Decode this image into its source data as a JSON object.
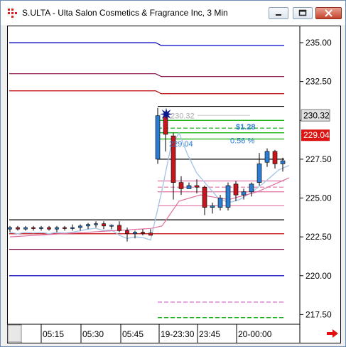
{
  "window": {
    "title": "S.ULTA - Ulta Salon Cosmetics & Fragrance Inc, 3 Min",
    "minimize_icon": "minimize-icon",
    "maximize_icon": "maximize-icon",
    "close_icon": "close-icon",
    "app_icon": "chart-app-icon"
  },
  "colors": {
    "background": "#ffffff",
    "up_candle": "#2a7dd1",
    "down_candle": "#c4161c",
    "last_price_badge": "#e1e1e1",
    "bid_ask_badge": "#dc1414",
    "avg_line": "#a8c6e8",
    "pink_line": "#e070a0"
  },
  "chart_data": {
    "type": "candlestick",
    "title": "S.ULTA - Ulta Salon Cosmetics & Fragrance Inc, 3 Min",
    "ylim": [
      216.5,
      236.5
    ],
    "yticks": [
      235.0,
      232.5,
      230.0,
      227.5,
      225.0,
      222.5,
      220.0,
      217.5
    ],
    "ytick_labels": [
      "235.00",
      "232.50",
      "227.50",
      "225.00",
      "222.50",
      "220.00",
      "217.50"
    ],
    "xtick_labels": [
      "05:15",
      "05:30",
      "05:45",
      "19-23:30",
      "23:45",
      "20-00:00"
    ],
    "last_price": 230.32,
    "last_price_label": "230.32",
    "second_price": 229.04,
    "second_price_label": "229.04",
    "change_label": "$1.28",
    "change_pct_label": "0.56 %",
    "high_annotation": "230.32",
    "low_annotation": "229.04",
    "candles_before_gap": [
      {
        "o": 223.0,
        "h": 223.2,
        "l": 222.8,
        "c": 223.1
      },
      {
        "o": 223.1,
        "h": 223.2,
        "l": 222.9,
        "c": 223.0
      },
      {
        "o": 223.0,
        "h": 223.2,
        "l": 222.9,
        "c": 223.1
      },
      {
        "o": 223.1,
        "h": 223.2,
        "l": 222.9,
        "c": 223.05
      },
      {
        "o": 223.05,
        "h": 223.2,
        "l": 222.9,
        "c": 223.1
      },
      {
        "o": 223.1,
        "h": 223.2,
        "l": 222.9,
        "c": 223.0
      },
      {
        "o": 223.0,
        "h": 223.2,
        "l": 222.8,
        "c": 223.1
      },
      {
        "o": 223.1,
        "h": 223.2,
        "l": 222.9,
        "c": 223.05
      },
      {
        "o": 223.05,
        "h": 223.3,
        "l": 222.9,
        "c": 223.1
      },
      {
        "o": 223.1,
        "h": 223.3,
        "l": 222.9,
        "c": 223.2
      },
      {
        "o": 223.2,
        "h": 223.4,
        "l": 223.0,
        "c": 223.3
      },
      {
        "o": 223.3,
        "h": 223.5,
        "l": 223.1,
        "c": 223.35
      },
      {
        "o": 223.35,
        "h": 223.5,
        "l": 223.0,
        "c": 223.2
      },
      {
        "o": 223.2,
        "h": 223.3,
        "l": 223.0,
        "c": 223.25
      },
      {
        "o": 223.25,
        "h": 223.5,
        "l": 222.8,
        "c": 222.9
      },
      {
        "o": 222.9,
        "h": 223.1,
        "l": 222.2,
        "c": 222.7
      },
      {
        "o": 222.7,
        "h": 222.9,
        "l": 222.4,
        "c": 222.8
      },
      {
        "o": 222.8,
        "h": 223.0,
        "l": 222.6,
        "c": 222.75
      },
      {
        "o": 222.75,
        "h": 223.0,
        "l": 222.6,
        "c": 222.6
      }
    ],
    "candles_after_gap": [
      {
        "o": 227.5,
        "h": 230.8,
        "l": 227.2,
        "c": 230.3
      },
      {
        "o": 230.3,
        "h": 230.4,
        "l": 228.0,
        "c": 229.1
      },
      {
        "o": 229.0,
        "h": 229.2,
        "l": 224.9,
        "c": 226.0
      },
      {
        "o": 226.0,
        "h": 226.4,
        "l": 225.2,
        "c": 225.6
      },
      {
        "o": 225.6,
        "h": 226.0,
        "l": 225.6,
        "c": 225.8
      },
      {
        "o": 225.8,
        "h": 226.2,
        "l": 225.3,
        "c": 225.7
      },
      {
        "o": 225.7,
        "h": 225.8,
        "l": 223.9,
        "c": 224.4
      },
      {
        "o": 224.4,
        "h": 224.7,
        "l": 224.0,
        "c": 224.5
      },
      {
        "o": 224.4,
        "h": 225.2,
        "l": 224.2,
        "c": 225.0
      },
      {
        "o": 224.4,
        "h": 226.0,
        "l": 224.2,
        "c": 225.8
      },
      {
        "o": 225.9,
        "h": 226.1,
        "l": 224.8,
        "c": 225.2
      },
      {
        "o": 225.2,
        "h": 225.6,
        "l": 224.9,
        "c": 225.4
      },
      {
        "o": 225.4,
        "h": 226.0,
        "l": 225.1,
        "c": 225.9
      },
      {
        "o": 226.0,
        "h": 227.9,
        "l": 225.8,
        "c": 227.2
      },
      {
        "o": 227.3,
        "h": 228.2,
        "l": 227.0,
        "c": 228.0
      },
      {
        "o": 228.0,
        "h": 228.1,
        "l": 226.9,
        "c": 227.2
      },
      {
        "o": 227.2,
        "h": 227.6,
        "l": 226.7,
        "c": 227.4
      }
    ],
    "levels": [
      {
        "price": 235.0,
        "color": "#0000c8",
        "style": "solid"
      },
      {
        "price": 233.0,
        "color": "#800040",
        "style": "solid"
      },
      {
        "price": 231.9,
        "color": "#c00000",
        "style": "solid"
      },
      {
        "price": 230.9,
        "color": "#000000",
        "style": "solid"
      },
      {
        "price": 230.0,
        "color": "#00aa00",
        "style": "solid"
      },
      {
        "price": 229.5,
        "color": "#00aa00",
        "style": "dashed"
      },
      {
        "price": 229.2,
        "color": "#00aa00",
        "style": "solid"
      },
      {
        "price": 228.8,
        "color": "#00aa00",
        "style": "solid"
      },
      {
        "price": 227.5,
        "color": "#000000",
        "style": "solid"
      },
      {
        "price": 226.1,
        "color": "#e070a0",
        "style": "solid"
      },
      {
        "price": 225.7,
        "color": "#e070a0",
        "style": "dashed"
      },
      {
        "price": 225.4,
        "color": "#e070a0",
        "style": "solid"
      },
      {
        "price": 224.5,
        "color": "#e070a0",
        "style": "solid"
      },
      {
        "price": 223.6,
        "color": "#000000",
        "style": "solid"
      },
      {
        "price": 222.7,
        "color": "#c00000",
        "style": "solid"
      },
      {
        "price": 221.7,
        "color": "#800040",
        "style": "solid"
      },
      {
        "price": 220.0,
        "color": "#0000c8",
        "style": "solid"
      },
      {
        "price": 218.3,
        "color": "#d060c0",
        "style": "dashed"
      },
      {
        "price": 217.3,
        "color": "#00aa00",
        "style": "dashed"
      }
    ]
  }
}
